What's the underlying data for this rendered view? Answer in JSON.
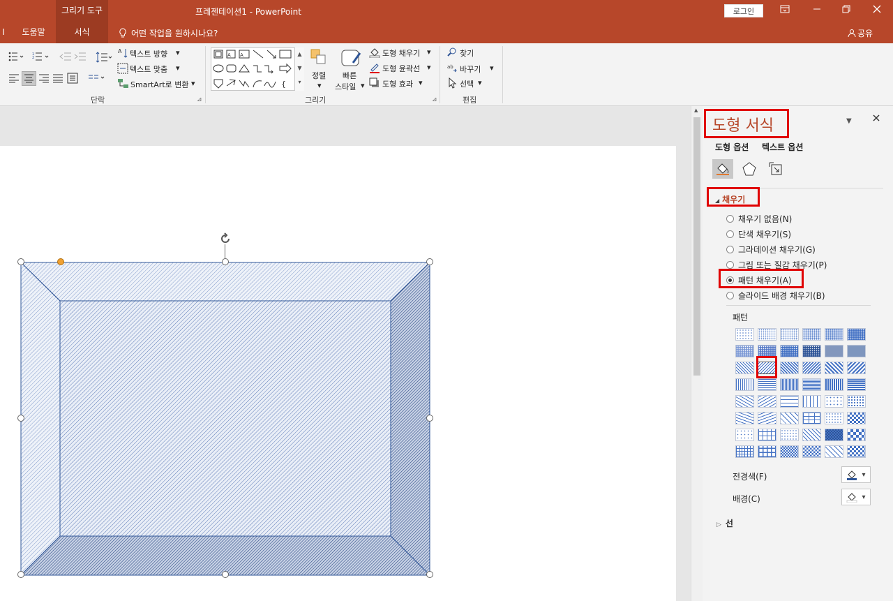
{
  "titlebar": {
    "context_tool": "그리기 도구",
    "doc_title": "프레젠테이션1  -  PowerPoint",
    "login": "로그인"
  },
  "tabs": {
    "help": "도움말",
    "format": "서식",
    "tellme": "어떤 작업을 원하시나요?",
    "share": "공유",
    "left_fragment": "I"
  },
  "ribbon": {
    "paragraph": {
      "label": "단락",
      "text_direction": "텍스트 방향",
      "align_text": "텍스트 맞춤",
      "smartart": "SmartArt로 변환"
    },
    "drawing": {
      "label": "그리기",
      "arrange": "정렬",
      "quick_styles_1": "빠른",
      "quick_styles_2": "스타일",
      "shape_fill": "도형 채우기",
      "shape_outline": "도형 윤곽선",
      "shape_effects": "도형 효과"
    },
    "editing": {
      "label": "편집",
      "find": "찾기",
      "replace": "바꾸기",
      "select": "선택"
    }
  },
  "pane": {
    "title": "도형 서식",
    "tab_shape": "도형 옵션",
    "tab_text": "텍스트 옵션",
    "fill_section": "채우기",
    "fill_options": [
      {
        "label": "채우기 없음(N)",
        "checked": false
      },
      {
        "label": "단색 채우기(S)",
        "checked": false
      },
      {
        "label": "그라데이션 채우기(G)",
        "checked": false
      },
      {
        "label": "그림 또는 질감 채우기(P)",
        "checked": false
      },
      {
        "label": "패턴 채우기(A)",
        "checked": true
      },
      {
        "label": "슬라이드 배경 채우기(B)",
        "checked": false
      }
    ],
    "pattern_label": "패턴",
    "foreground_label": "전경색(F)",
    "background_label": "배경(C)",
    "line_section": "선",
    "selected_pattern_index": 13
  },
  "colors": {
    "accent": "#b7472a",
    "highlight": "#e00000",
    "pattern_blue": "#4472c4",
    "shape_fill": "#dce6f4",
    "shape_line": "#2f5597"
  }
}
